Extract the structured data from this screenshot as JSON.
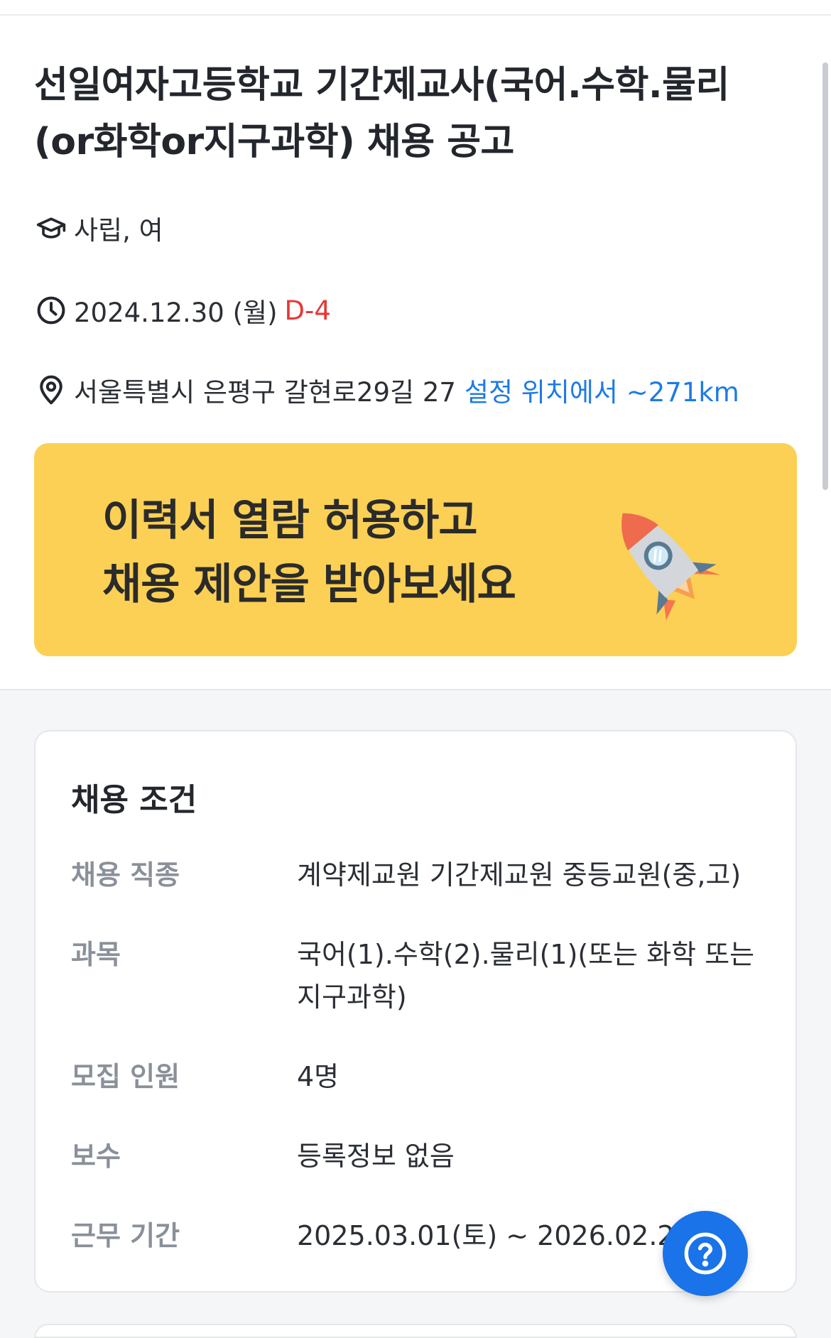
{
  "posting": {
    "title": "선일여자고등학교 기간제교사(국어.수학.물리(or화학or지구과학) 채용 공고",
    "school_type": "사립, 여",
    "deadline_date": "2024.12.30 (월)",
    "dday": "D-4",
    "address": "서울특별시 은평구 갈현로29길 27",
    "distance": "설정 위치에서 ~271km"
  },
  "banner": {
    "line1": "이력서 열람 허용하고",
    "line2": "채용 제안을 받아보세요",
    "background_color": "#fcd054"
  },
  "conditions": {
    "title": "채용 조건",
    "rows": [
      {
        "label": "채용 직종",
        "value": "계약제교원 기간제교원  중등교원(중,고)"
      },
      {
        "label": "과목",
        "value": "국어(1).수학(2).물리(1)(또는 화학 또는 지구과학)"
      },
      {
        "label": "모집 인원",
        "value": "4명"
      },
      {
        "label": "보수",
        "value": "등록정보 없음"
      },
      {
        "label": "근무 기간",
        "value": "2025.03.01(토) ~ 2026.02.28(토)"
      }
    ]
  },
  "icons": {
    "school": "graduation-cap-icon",
    "deadline": "clock-icon",
    "address": "map-pin-icon",
    "help": "question-icon"
  },
  "colors": {
    "dday": "#e53935",
    "distance": "#1e7be4",
    "help_button": "#1a73e8"
  }
}
